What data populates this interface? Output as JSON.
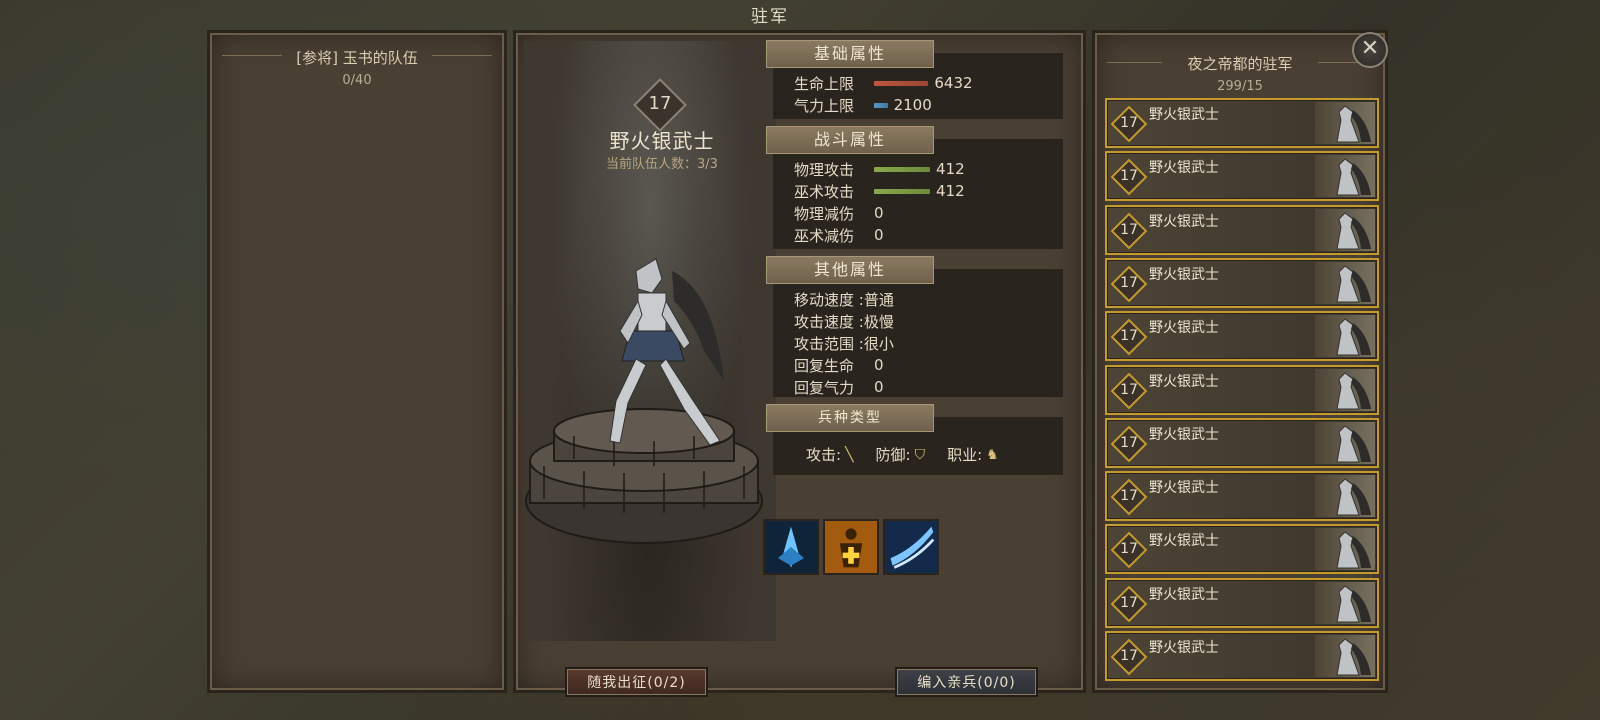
{
  "window_title": "驻军",
  "left_panel": {
    "title": "[参将] 玉书的队伍",
    "count": "0/40"
  },
  "unit_detail": {
    "level": "17",
    "name": "野火银武士",
    "squad_size_label": "当前队伍人数：3/3",
    "basic": {
      "tab": "基础属性",
      "hp_label": "生命上限",
      "hp_value": "6432",
      "hp_bar_fraction": 0.8,
      "energy_label": "气力上限",
      "energy_value": "2100",
      "energy_bar_fraction": 0.2
    },
    "combat": {
      "tab": "战斗属性",
      "phys_atk_label": "物理攻击",
      "phys_atk_value": "412",
      "phys_atk_bar_fraction": 0.7,
      "magic_atk_label": "巫术攻击",
      "magic_atk_value": "412",
      "magic_atk_bar_fraction": 0.7,
      "phys_def_label": "物理减伤",
      "phys_def_value": "0",
      "magic_def_label": "巫术减伤",
      "magic_def_value": "0"
    },
    "other": {
      "tab": "其他属性",
      "move_speed": "移动速度 :普通",
      "attack_speed": "攻击速度 :极慢",
      "attack_range": "攻击范围 :很小",
      "regen_hp_label": "回复生命",
      "regen_hp_value": "0",
      "regen_energy_label": "回复气力",
      "regen_energy_value": "0"
    },
    "troop_type": {
      "tab": "兵种类型",
      "attack_label": "攻击:",
      "defense_label": "防御:",
      "class_label": "职业:"
    },
    "skills": [
      "ice-spike-icon",
      "heal-aura-icon",
      "slash-icon"
    ],
    "follow_button": "随我出征(0/2)",
    "guard_button": "编入亲兵(0/0)"
  },
  "garrison": {
    "title": "夜之帝都的驻军",
    "count": "299/15",
    "units": [
      {
        "level": "17",
        "name": "野火银武士"
      },
      {
        "level": "17",
        "name": "野火银武士"
      },
      {
        "level": "17",
        "name": "野火银武士"
      },
      {
        "level": "17",
        "name": "野火银武士"
      },
      {
        "level": "17",
        "name": "野火银武士"
      },
      {
        "level": "17",
        "name": "野火银武士"
      },
      {
        "level": "17",
        "name": "野火银武士"
      },
      {
        "level": "17",
        "name": "野火银武士"
      },
      {
        "level": "17",
        "name": "野火银武士"
      },
      {
        "level": "17",
        "name": "野火银武士"
      },
      {
        "level": "17",
        "name": "野火银武士"
      }
    ]
  },
  "colors": {
    "card_border": "#c49a2e",
    "hp_bar": "#c0563f",
    "energy_bar": "#5a96c4",
    "attack_bar": "#8aa84d"
  }
}
